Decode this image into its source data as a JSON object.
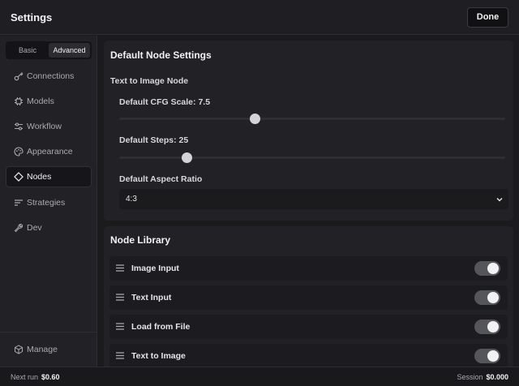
{
  "window": {
    "title": "Settings",
    "done_label": "Done"
  },
  "sidebar": {
    "mode_tabs": [
      {
        "label": "Basic"
      },
      {
        "label": "Advanced"
      }
    ],
    "items": [
      {
        "label": "Connections",
        "icon": "key-icon"
      },
      {
        "label": "Models",
        "icon": "chip-icon"
      },
      {
        "label": "Workflow",
        "icon": "sliders-icon"
      },
      {
        "label": "Appearance",
        "icon": "palette-icon"
      },
      {
        "label": "Nodes",
        "icon": "diamond-icon",
        "active": true
      },
      {
        "label": "Strategies",
        "icon": "lines-icon"
      },
      {
        "label": "Dev",
        "icon": "wrench-icon"
      }
    ],
    "manage": {
      "label": "Manage",
      "icon": "cube-icon"
    }
  },
  "default_node_settings": {
    "title": "Default Node Settings",
    "section": "Text to Image Node",
    "cfg_scale": {
      "label": "Default CFG Scale: 7.5",
      "value": 7.5,
      "fraction": 0.35
    },
    "steps": {
      "label": "Default Steps: 25",
      "value": 25,
      "fraction": 0.175
    },
    "aspect_ratio": {
      "label": "Default Aspect Ratio",
      "value": "4:3"
    }
  },
  "node_library": {
    "title": "Node Library",
    "items": [
      {
        "label": "Image Input",
        "enabled": true
      },
      {
        "label": "Text Input",
        "enabled": true
      },
      {
        "label": "Load from File",
        "enabled": true
      },
      {
        "label": "Text to Image",
        "enabled": true
      }
    ]
  },
  "footer": {
    "next_run_label": "Next run",
    "next_run_value": "$0.60",
    "session_label": "Session",
    "session_value": "$0.000"
  },
  "colors": {
    "background": "#1b1b1e",
    "panel": "#222226",
    "toggle_on": "#55555c"
  }
}
